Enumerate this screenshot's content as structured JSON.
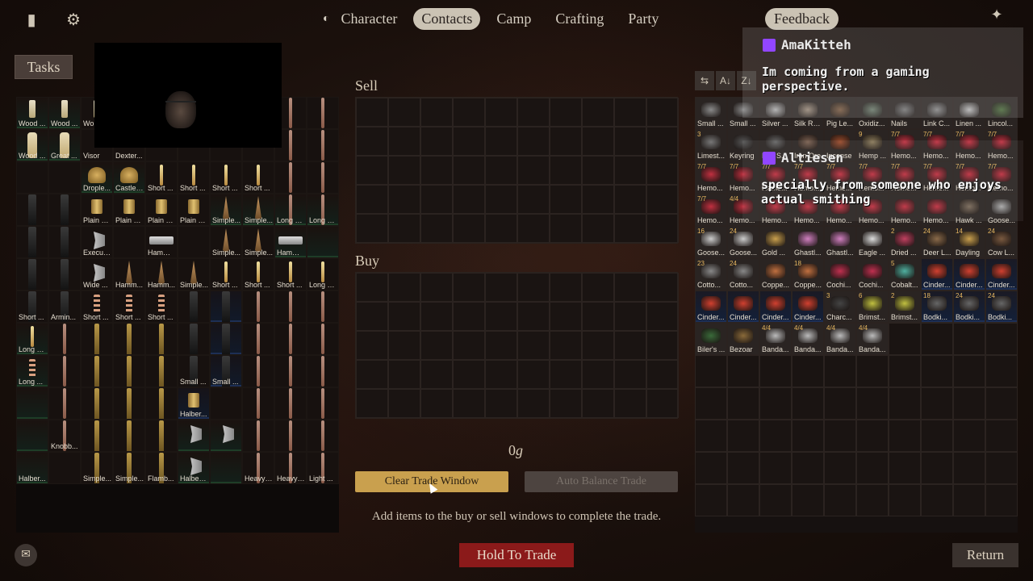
{
  "nav": {
    "tabs": [
      {
        "label": "Character",
        "active": false
      },
      {
        "label": "Contacts",
        "active": true
      },
      {
        "label": "Camp",
        "active": false
      },
      {
        "label": "Crafting",
        "active": false
      },
      {
        "label": "Party",
        "active": false
      }
    ],
    "feedback_label": "Feedback"
  },
  "icons": {
    "journal": "journal-icon",
    "settings": "gear-icon",
    "tool": "tool-icon",
    "chat": "chat-icon"
  },
  "tasks_label": "Tasks",
  "left_inventory": [
    {
      "label": "Wood ...",
      "tier": "g",
      "shape": "short"
    },
    {
      "label": "Wood ...",
      "tier": "g",
      "shape": "short"
    },
    {
      "label": "Wo",
      "tier": "",
      "shape": "short"
    },
    {
      "label": "",
      "tier": "",
      "shape": ""
    },
    {
      "label": "",
      "tier": "",
      "shape": ""
    },
    {
      "label": "",
      "tier": "",
      "shape": ""
    },
    {
      "label": "",
      "tier": "",
      "shape": ""
    },
    {
      "label": "",
      "tier": "",
      "shape": ""
    },
    {
      "label": "",
      "tier": "",
      "shape": "pole"
    },
    {
      "label": "",
      "tier": "",
      "shape": "pole"
    },
    {
      "label": "Wood ...",
      "tier": "g",
      "shape": "club"
    },
    {
      "label": "Great ...",
      "tier": "g",
      "shape": "club"
    },
    {
      "label": "Visor",
      "tier": "",
      "shape": ""
    },
    {
      "label": "Dexter...",
      "tier": "",
      "shape": ""
    },
    {
      "label": "",
      "tier": "",
      "shape": ""
    },
    {
      "label": "",
      "tier": "",
      "shape": ""
    },
    {
      "label": "",
      "tier": "",
      "shape": ""
    },
    {
      "label": "",
      "tier": "",
      "shape": ""
    },
    {
      "label": "",
      "tier": "",
      "shape": "pole"
    },
    {
      "label": "",
      "tier": "",
      "shape": "pole"
    },
    {
      "label": "",
      "tier": "",
      "shape": ""
    },
    {
      "label": "",
      "tier": "",
      "shape": ""
    },
    {
      "label": "Drople...",
      "tier": "g",
      "shape": "helm"
    },
    {
      "label": "Castle ...",
      "tier": "g",
      "shape": "helm"
    },
    {
      "label": "Short ...",
      "tier": "",
      "shape": "stick"
    },
    {
      "label": "Short ...",
      "tier": "",
      "shape": "stick"
    },
    {
      "label": "Short ...",
      "tier": "",
      "shape": "stick"
    },
    {
      "label": "Short ...",
      "tier": "",
      "shape": "stick"
    },
    {
      "label": "",
      "tier": "",
      "shape": "pole"
    },
    {
      "label": "",
      "tier": "",
      "shape": "pole"
    },
    {
      "label": "",
      "tier": "",
      "shape": "dark"
    },
    {
      "label": "",
      "tier": "",
      "shape": "dark"
    },
    {
      "label": "Plain S...",
      "tier": "",
      "shape": "plate"
    },
    {
      "label": "Plain S...",
      "tier": "",
      "shape": "plate"
    },
    {
      "label": "Plain S...",
      "tier": "",
      "shape": "plate"
    },
    {
      "label": "Plain S...",
      "tier": "",
      "shape": "plate"
    },
    {
      "label": "Simple...",
      "tier": "g",
      "shape": "spear"
    },
    {
      "label": "Simple...",
      "tier": "g",
      "shape": "spear"
    },
    {
      "label": "Long S...",
      "tier": "g",
      "shape": "pole"
    },
    {
      "label": "Long S...",
      "tier": "g",
      "shape": "pole"
    },
    {
      "label": "",
      "tier": "",
      "shape": "dark"
    },
    {
      "label": "",
      "tier": "",
      "shape": "dark"
    },
    {
      "label": "Executioneers' A...",
      "tier": "",
      "shape": "axe"
    },
    {
      "label": "",
      "tier": "",
      "shape": ""
    },
    {
      "label": "Hammer Head",
      "tier": "",
      "shape": "hammer"
    },
    {
      "label": "",
      "tier": "",
      "shape": ""
    },
    {
      "label": "Simple...",
      "tier": "",
      "shape": "spear"
    },
    {
      "label": "Simple...",
      "tier": "",
      "shape": "spear"
    },
    {
      "label": "Hammer Head",
      "tier": "g",
      "shape": "hammer"
    },
    {
      "label": "",
      "tier": "g",
      "shape": ""
    },
    {
      "label": "",
      "tier": "",
      "shape": "dark"
    },
    {
      "label": "",
      "tier": "",
      "shape": "dark"
    },
    {
      "label": "Wide ...",
      "tier": "",
      "shape": "axe"
    },
    {
      "label": "Hamm...",
      "tier": "",
      "shape": "spear"
    },
    {
      "label": "Hamm...",
      "tier": "",
      "shape": "spear"
    },
    {
      "label": "Simple...",
      "tier": "",
      "shape": "spear"
    },
    {
      "label": "Short ...",
      "tier": "",
      "shape": "stick"
    },
    {
      "label": "Short ...",
      "tier": "",
      "shape": "stick"
    },
    {
      "label": "Short ...",
      "tier": "",
      "shape": "stick"
    },
    {
      "label": "Long S...",
      "tier": "",
      "shape": "stick"
    },
    {
      "label": "Short ...",
      "tier": "",
      "shape": "dark"
    },
    {
      "label": "Armin...",
      "tier": "",
      "shape": "dark"
    },
    {
      "label": "Short ...",
      "tier": "",
      "shape": "chain"
    },
    {
      "label": "Short ...",
      "tier": "",
      "shape": "chain"
    },
    {
      "label": "Short ...",
      "tier": "",
      "shape": "chain"
    },
    {
      "label": "",
      "tier": "",
      "shape": "dark"
    },
    {
      "label": "",
      "tier": "b",
      "shape": "dark"
    },
    {
      "label": "",
      "tier": "",
      "shape": "pole"
    },
    {
      "label": "",
      "tier": "",
      "shape": "pole"
    },
    {
      "label": "",
      "tier": "",
      "shape": "pole"
    },
    {
      "label": "Long S...",
      "tier": "g",
      "shape": "stick"
    },
    {
      "label": "",
      "tier": "",
      "shape": "pole"
    },
    {
      "label": "",
      "tier": "",
      "shape": "gold"
    },
    {
      "label": "",
      "tier": "",
      "shape": "gold"
    },
    {
      "label": "",
      "tier": "",
      "shape": "gold"
    },
    {
      "label": "",
      "tier": "",
      "shape": "dark"
    },
    {
      "label": "",
      "tier": "b",
      "shape": "dark"
    },
    {
      "label": "",
      "tier": "",
      "shape": "pole"
    },
    {
      "label": "",
      "tier": "",
      "shape": "pole"
    },
    {
      "label": "",
      "tier": "",
      "shape": "pole"
    },
    {
      "label": "Long ...",
      "tier": "g",
      "shape": "chain"
    },
    {
      "label": "",
      "tier": "",
      "shape": "pole"
    },
    {
      "label": "",
      "tier": "",
      "shape": "gold"
    },
    {
      "label": "",
      "tier": "",
      "shape": "gold"
    },
    {
      "label": "",
      "tier": "",
      "shape": "gold"
    },
    {
      "label": "Small ...",
      "tier": "",
      "shape": "dark"
    },
    {
      "label": "Small ...",
      "tier": "b",
      "shape": "dark"
    },
    {
      "label": "",
      "tier": "",
      "shape": "pole"
    },
    {
      "label": "",
      "tier": "",
      "shape": "pole"
    },
    {
      "label": "",
      "tier": "",
      "shape": "pole"
    },
    {
      "label": "",
      "tier": "g",
      "shape": ""
    },
    {
      "label": "",
      "tier": "",
      "shape": "pole"
    },
    {
      "label": "",
      "tier": "",
      "shape": "gold"
    },
    {
      "label": "",
      "tier": "",
      "shape": "gold"
    },
    {
      "label": "",
      "tier": "",
      "shape": "gold"
    },
    {
      "label": "Halber...",
      "tier": "b",
      "shape": "plate"
    },
    {
      "label": "",
      "tier": "",
      "shape": ""
    },
    {
      "label": "",
      "tier": "",
      "shape": "pole"
    },
    {
      "label": "",
      "tier": "",
      "shape": "pole"
    },
    {
      "label": "",
      "tier": "",
      "shape": "pole"
    },
    {
      "label": "",
      "tier": "g",
      "shape": ""
    },
    {
      "label": "Knobb...",
      "tier": "",
      "shape": "pole"
    },
    {
      "label": "",
      "tier": "",
      "shape": "gold"
    },
    {
      "label": "",
      "tier": "",
      "shape": "gold"
    },
    {
      "label": "",
      "tier": "",
      "shape": "gold"
    },
    {
      "label": "",
      "tier": "g",
      "shape": "axe"
    },
    {
      "label": "",
      "tier": "g",
      "shape": "axe"
    },
    {
      "label": "",
      "tier": "",
      "shape": "pole"
    },
    {
      "label": "",
      "tier": "",
      "shape": "pole"
    },
    {
      "label": "",
      "tier": "",
      "shape": "pole"
    },
    {
      "label": "Halber...",
      "tier": "g",
      "shape": ""
    },
    {
      "label": "",
      "tier": "",
      "shape": ""
    },
    {
      "label": "Simple...",
      "tier": "",
      "shape": "gold"
    },
    {
      "label": "Simple...",
      "tier": "",
      "shape": "gold"
    },
    {
      "label": "Flamb...",
      "tier": "",
      "shape": "gold"
    },
    {
      "label": "Halberd Curved ...",
      "tier": "g",
      "shape": "axe"
    },
    {
      "label": "",
      "tier": "g",
      "shape": ""
    },
    {
      "label": "Heavy ...",
      "tier": "",
      "shape": "pole"
    },
    {
      "label": "Heavy ...",
      "tier": "",
      "shape": "pole"
    },
    {
      "label": "Light ...",
      "tier": "",
      "shape": "pole"
    }
  ],
  "trade": {
    "sell_label": "Sell",
    "buy_label": "Buy",
    "gold_value": "0",
    "gold_unit": "g",
    "clear_label": "Clear Trade Window",
    "auto_label": "Auto Balance Trade",
    "hint": "Add items to the buy or sell windows to complete the trade."
  },
  "sort_icons": [
    "collapse-icon",
    "sort-alpha-asc-icon",
    "sort-alpha-desc-icon"
  ],
  "sort_glyphs": [
    "⇆",
    "A↓",
    "Z↓"
  ],
  "right_inventory": [
    {
      "label": "Small ...",
      "count": "",
      "tier": "",
      "color": "#8a8a8a"
    },
    {
      "label": "Small ...",
      "count": "",
      "tier": "",
      "color": "#8a8a8a"
    },
    {
      "label": "Silver ...",
      "count": "",
      "tier": "",
      "color": "#b0b0b0"
    },
    {
      "label": "Silk Ra...",
      "count": "",
      "tier": "",
      "color": "#9a8a7a"
    },
    {
      "label": "Pig Le...",
      "count": "",
      "tier": "",
      "color": "#7a5a40"
    },
    {
      "label": "Oxidiz...",
      "count": "",
      "tier": "",
      "color": "#6a7a6a"
    },
    {
      "label": "Nails",
      "count": "",
      "tier": "",
      "color": "#777"
    },
    {
      "label": "Link C...",
      "count": "",
      "tier": "",
      "color": "#888"
    },
    {
      "label": "Linen ...",
      "count": "",
      "tier": "",
      "color": "#bbb"
    },
    {
      "label": "Lincol...",
      "count": "",
      "tier": "",
      "color": "#4a6a3a"
    },
    {
      "label": "Limest...",
      "count": "3",
      "tier": "",
      "color": "#777"
    },
    {
      "label": "Keyring",
      "count": "",
      "tier": "",
      "color": "#555"
    },
    {
      "label": "Iron S...",
      "count": "",
      "tier": "",
      "color": "#666"
    },
    {
      "label": "Iron Ore",
      "count": "",
      "tier": "",
      "color": "#7a6050"
    },
    {
      "label": "Incense",
      "count": "",
      "tier": "",
      "color": "#9a4a2a"
    },
    {
      "label": "Hemp ...",
      "count": "9",
      "tier": "",
      "color": "#8a7a5a"
    },
    {
      "label": "Hemo...",
      "count": "7/7",
      "tier": "",
      "color": "#c03040"
    },
    {
      "label": "Hemo...",
      "count": "7/7",
      "tier": "",
      "color": "#c03040"
    },
    {
      "label": "Hemo...",
      "count": "7/7",
      "tier": "",
      "color": "#c03040"
    },
    {
      "label": "Hemo...",
      "count": "7/7",
      "tier": "",
      "color": "#c03040"
    },
    {
      "label": "Hemo...",
      "count": "7/7",
      "tier": "",
      "color": "#c03040"
    },
    {
      "label": "Hemo...",
      "count": "7/7",
      "tier": "",
      "color": "#c03040"
    },
    {
      "label": "Hemo...",
      "count": "7/7",
      "tier": "",
      "color": "#c03040"
    },
    {
      "label": "Hemo...",
      "count": "7/7",
      "tier": "",
      "color": "#c03040"
    },
    {
      "label": "Hemo...",
      "count": "7/7",
      "tier": "",
      "color": "#c03040"
    },
    {
      "label": "Hemo...",
      "count": "7/7",
      "tier": "",
      "color": "#c03040"
    },
    {
      "label": "Hemo...",
      "count": "7/7",
      "tier": "",
      "color": "#c03040"
    },
    {
      "label": "Hemo...",
      "count": "7/7",
      "tier": "",
      "color": "#c03040"
    },
    {
      "label": "Hemo...",
      "count": "7/7",
      "tier": "",
      "color": "#c03040"
    },
    {
      "label": "Hemo...",
      "count": "7/7",
      "tier": "",
      "color": "#c03040"
    },
    {
      "label": "Hemo...",
      "count": "7/7",
      "tier": "",
      "color": "#c03040"
    },
    {
      "label": "Hemo...",
      "count": "4/4",
      "tier": "",
      "color": "#c03040"
    },
    {
      "label": "Hemo...",
      "count": "",
      "tier": "",
      "color": "#c03040"
    },
    {
      "label": "Hemo...",
      "count": "",
      "tier": "",
      "color": "#c03040"
    },
    {
      "label": "Hemo...",
      "count": "",
      "tier": "",
      "color": "#c03040"
    },
    {
      "label": "Hemo...",
      "count": "",
      "tier": "",
      "color": "#c03040"
    },
    {
      "label": "Hemo...",
      "count": "",
      "tier": "",
      "color": "#c03040"
    },
    {
      "label": "Hemo...",
      "count": "",
      "tier": "",
      "color": "#c03040"
    },
    {
      "label": "Hawk ...",
      "count": "",
      "tier": "",
      "color": "#7a6a5a"
    },
    {
      "label": "Goose...",
      "count": "",
      "tier": "",
      "color": "#aaa"
    },
    {
      "label": "Goose...",
      "count": "16",
      "tier": "",
      "color": "#ccc"
    },
    {
      "label": "Goose...",
      "count": "24",
      "tier": "",
      "color": "#ccc"
    },
    {
      "label": "Gold ...",
      "count": "",
      "tier": "",
      "color": "#c9a04e"
    },
    {
      "label": "Ghastl...",
      "count": "",
      "tier": "",
      "color": "#d080c0"
    },
    {
      "label": "Ghastl...",
      "count": "",
      "tier": "",
      "color": "#d080c0"
    },
    {
      "label": "Eagle ...",
      "count": "",
      "tier": "",
      "color": "#ddd"
    },
    {
      "label": "Dried ...",
      "count": "2",
      "tier": "",
      "color": "#c04060"
    },
    {
      "label": "Deer L...",
      "count": "24",
      "tier": "",
      "color": "#8a6a4a"
    },
    {
      "label": "Dayling",
      "count": "14",
      "tier": "",
      "color": "#c9a04e"
    },
    {
      "label": "Cow L...",
      "count": "24",
      "tier": "",
      "color": "#7a5a40"
    },
    {
      "label": "Cotto...",
      "count": "23",
      "tier": "",
      "color": "#888"
    },
    {
      "label": "Cotto...",
      "count": "24",
      "tier": "",
      "color": "#888"
    },
    {
      "label": "Coppe...",
      "count": "",
      "tier": "",
      "color": "#c07040"
    },
    {
      "label": "Coppe...",
      "count": "18",
      "tier": "",
      "color": "#c07040"
    },
    {
      "label": "Cochi...",
      "count": "",
      "tier": "",
      "color": "#c03050"
    },
    {
      "label": "Cochi...",
      "count": "",
      "tier": "",
      "color": "#c03050"
    },
    {
      "label": "Cobalt...",
      "count": "5",
      "tier": "",
      "color": "#50b0a0"
    },
    {
      "label": "Cinder...",
      "count": "",
      "tier": "b",
      "color": "#d04030"
    },
    {
      "label": "Cinder...",
      "count": "",
      "tier": "b",
      "color": "#d04030"
    },
    {
      "label": "Cinder...",
      "count": "",
      "tier": "b",
      "color": "#d04030"
    },
    {
      "label": "Cinder...",
      "count": "",
      "tier": "b",
      "color": "#d04030"
    },
    {
      "label": "Cinder...",
      "count": "",
      "tier": "b",
      "color": "#d04030"
    },
    {
      "label": "Cinder...",
      "count": "",
      "tier": "b",
      "color": "#d04030"
    },
    {
      "label": "Cinder...",
      "count": "",
      "tier": "b",
      "color": "#d04030"
    },
    {
      "label": "Charc...",
      "count": "3",
      "tier": "",
      "color": "#444"
    },
    {
      "label": "Brimst...",
      "count": "6",
      "tier": "",
      "color": "#c0c040"
    },
    {
      "label": "Brimst...",
      "count": "2",
      "tier": "",
      "color": "#c0c040"
    },
    {
      "label": "Bodki...",
      "count": "18",
      "tier": "b",
      "color": "#666"
    },
    {
      "label": "Bodki...",
      "count": "24",
      "tier": "b",
      "color": "#666"
    },
    {
      "label": "Bodki...",
      "count": "24",
      "tier": "b",
      "color": "#666"
    },
    {
      "label": "Biler's ...",
      "count": "",
      "tier": "",
      "color": "#3a6a3a"
    },
    {
      "label": "Bezoar",
      "count": "",
      "tier": "",
      "color": "#8a6a3a"
    },
    {
      "label": "Banda...",
      "count": "4/4",
      "tier": "",
      "color": "#bbb"
    },
    {
      "label": "Banda...",
      "count": "4/4",
      "tier": "",
      "color": "#bbb"
    },
    {
      "label": "Banda...",
      "count": "4/4",
      "tier": "",
      "color": "#bbb"
    },
    {
      "label": "Banda...",
      "count": "4/4",
      "tier": "",
      "color": "#bbb"
    }
  ],
  "chat": {
    "messages": [
      {
        "user": "AmaKitteh",
        "text": "Im coming from a gaming perspective."
      },
      {
        "user": "Altiesen",
        "text": "specially from someone who enjoys actual smithing"
      }
    ]
  },
  "footer": {
    "hold_label": "Hold To Trade",
    "return_label": "Return"
  }
}
